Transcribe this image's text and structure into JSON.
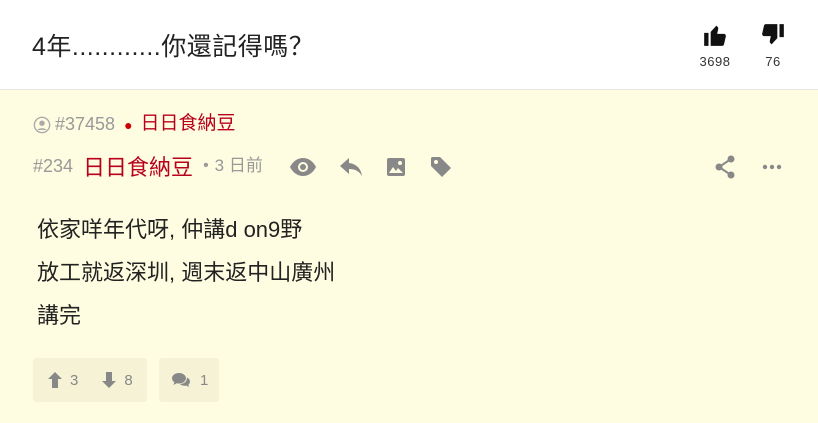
{
  "thread": {
    "title": "4年............你還記得嗎？"
  },
  "votes": {
    "like_count": "3698",
    "dislike_count": "76"
  },
  "quote": {
    "ref": "#37458",
    "author": "日日食納豆"
  },
  "post": {
    "floor": "#234",
    "author": "日日食納豆",
    "time": "3 日前",
    "lines": [
      "依家咩年代呀, 仲講d on9野",
      "放工就返深圳, 週末返中山廣州",
      "講完"
    ]
  },
  "reactions": {
    "up_count": "3",
    "down_count": "8",
    "reply_count": "1"
  },
  "colors": {
    "author": "#b8001c",
    "post_bg": "#fffde1",
    "icon": "#888888"
  }
}
